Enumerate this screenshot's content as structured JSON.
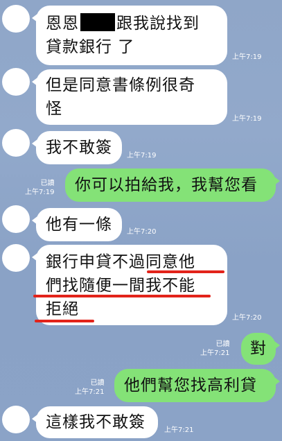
{
  "messages": [
    {
      "sender": "other",
      "lines": [
        "恩恩",
        "跟我說找到",
        "貸款銀行 了"
      ],
      "time": "上午7:19"
    },
    {
      "sender": "other",
      "lines": [
        "但是同意書條例很奇",
        "怪"
      ],
      "time": "上午7:19"
    },
    {
      "sender": "other",
      "lines": [
        "我不敢簽"
      ],
      "time": "上午7:19"
    },
    {
      "sender": "me",
      "lines": [
        "你可以拍給我，我幫您看"
      ],
      "read": "已讀",
      "time": "上午7:19"
    },
    {
      "sender": "other",
      "lines": [
        "他有一條"
      ],
      "time": "上午7:20"
    },
    {
      "sender": "other",
      "lines": [
        "銀行申貸不過同意他",
        "們找隨便一間我不能",
        "拒絕"
      ],
      "time": "上午7:20"
    },
    {
      "sender": "me",
      "lines": [
        "對"
      ],
      "read": "已讀",
      "time": "上午7:21"
    },
    {
      "sender": "me",
      "lines": [
        "他們幫您找高利貸"
      ],
      "read": "已讀",
      "time": "上午7:21"
    },
    {
      "sender": "other",
      "lines": [
        "這樣我不敢簽"
      ],
      "time": "上午7:21"
    }
  ],
  "colors": {
    "background": "#8fa6c8",
    "incoming_bubble": "#ffffff",
    "outgoing_bubble": "#84e277",
    "highlight_underline": "#e2231a",
    "redaction": "#000000"
  }
}
